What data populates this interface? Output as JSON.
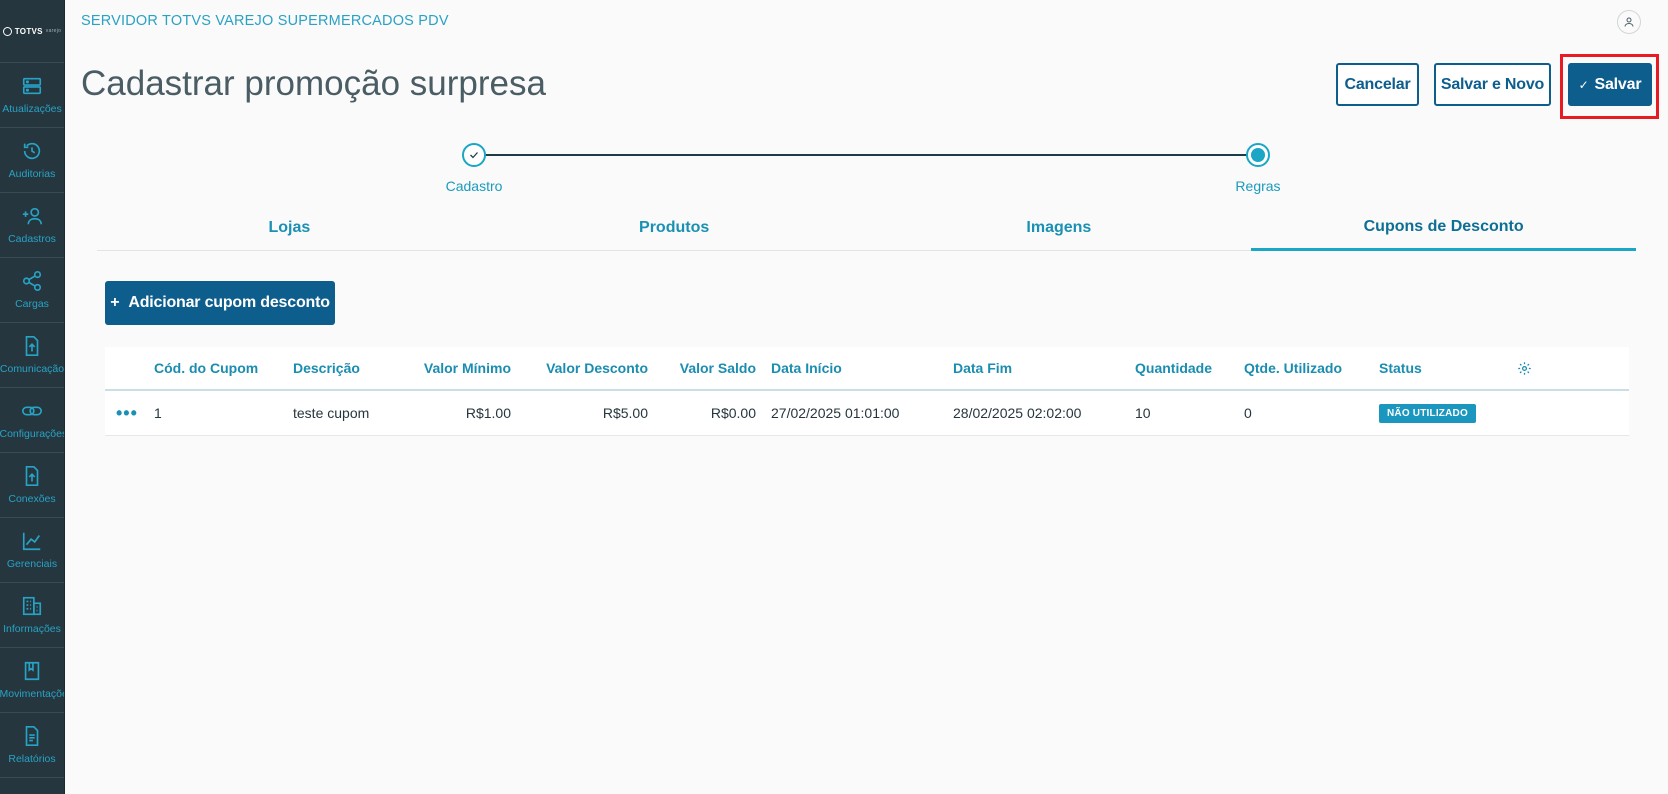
{
  "sidebar": {
    "logo": "TOTVS",
    "logo_sub": "varejo",
    "items": [
      {
        "label": "Atualizações",
        "icon": "server-icon"
      },
      {
        "label": "Auditorias",
        "icon": "history-icon"
      },
      {
        "label": "Cadastros",
        "icon": "add-user-icon"
      },
      {
        "label": "Cargas",
        "icon": "share-icon"
      },
      {
        "label": "Comunicação",
        "icon": "upload-file-icon"
      },
      {
        "label": "Configurações",
        "icon": "link-icon"
      },
      {
        "label": "Conexões",
        "icon": "upload-file-icon"
      },
      {
        "label": "Gerenciais",
        "icon": "chart-icon"
      },
      {
        "label": "Informações",
        "icon": "building-icon"
      },
      {
        "label": "Movimentações",
        "icon": "book-icon"
      },
      {
        "label": "Relatórios",
        "icon": "document-icon"
      }
    ]
  },
  "header": {
    "app_title": "SERVIDOR TOTVS VAREJO SUPERMERCADOS PDV",
    "page_title": "Cadastrar promoção surpresa",
    "cancel_label": "Cancelar",
    "save_new_label": "Salvar e Novo",
    "save_label": "Salvar"
  },
  "stepper": {
    "steps": [
      {
        "label": "Cadastro",
        "state": "done"
      },
      {
        "label": "Regras",
        "state": "current"
      }
    ]
  },
  "tabs": [
    {
      "label": "Lojas",
      "active": false
    },
    {
      "label": "Produtos",
      "active": false
    },
    {
      "label": "Imagens",
      "active": false
    },
    {
      "label": "Cupons de Desconto",
      "active": true
    }
  ],
  "add_button_label": "Adicionar cupom desconto",
  "table": {
    "columns": [
      "Cód. do Cupom",
      "Descrição",
      "Valor Mínimo",
      "Valor Desconto",
      "Valor Saldo",
      "Data Início",
      "Data Fim",
      "Quantidade",
      "Qtde. Utilizado",
      "Status"
    ],
    "rows": [
      {
        "actions": "•••",
        "codigo": "1",
        "descricao": "teste cupom",
        "valor_minimo": "R$1.00",
        "valor_desconto": "R$5.00",
        "valor_saldo": "R$0.00",
        "data_inicio": "27/02/2025 01:01:00",
        "data_fim": "28/02/2025 02:02:00",
        "quantidade": "10",
        "qtde_utilizado": "0",
        "status": "NÃO UTILIZADO"
      }
    ]
  },
  "colors": {
    "sidebar_bg": "#26363e",
    "accent": "#1aa6c4",
    "primary": "#0d5d8d",
    "highlight": "#e81b22"
  }
}
